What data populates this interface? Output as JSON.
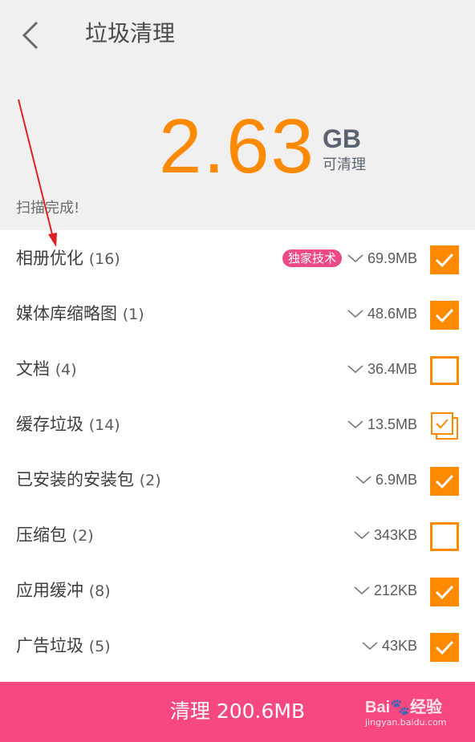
{
  "header": {
    "title": "垃圾清理"
  },
  "summary": {
    "amount": "2.63",
    "unit": "GB",
    "caption": "可清理",
    "status": "扫描完成!"
  },
  "items": [
    {
      "name": "相册优化",
      "count": "(16)",
      "badge": "独家技术",
      "size": "69.9MB",
      "state": "checked"
    },
    {
      "name": "媒体库缩略图",
      "count": "(1)",
      "badge": "",
      "size": "48.6MB",
      "state": "checked"
    },
    {
      "name": "文档",
      "count": "(4)",
      "badge": "",
      "size": "36.4MB",
      "state": "unchecked"
    },
    {
      "name": "缓存垃圾",
      "count": "(14)",
      "badge": "",
      "size": "13.5MB",
      "state": "partial"
    },
    {
      "name": "已安装的安装包",
      "count": "(2)",
      "badge": "",
      "size": "6.9MB",
      "state": "checked"
    },
    {
      "name": "压缩包",
      "count": "(2)",
      "badge": "",
      "size": "343KB",
      "state": "unchecked"
    },
    {
      "name": "应用缓冲",
      "count": "(8)",
      "badge": "",
      "size": "212KB",
      "state": "checked"
    },
    {
      "name": "广告垃圾",
      "count": "(5)",
      "badge": "",
      "size": "43KB",
      "state": "checked"
    }
  ],
  "footer": {
    "button_label": "清理 200.6MB"
  },
  "watermark": {
    "brand": "Bai🐾经验",
    "url": "jingyan.baidu.com"
  },
  "colors": {
    "accent": "#ff8a00",
    "button": "#f7487f",
    "badge": "#ec4a86",
    "annotation_arrow": "#e02020"
  }
}
